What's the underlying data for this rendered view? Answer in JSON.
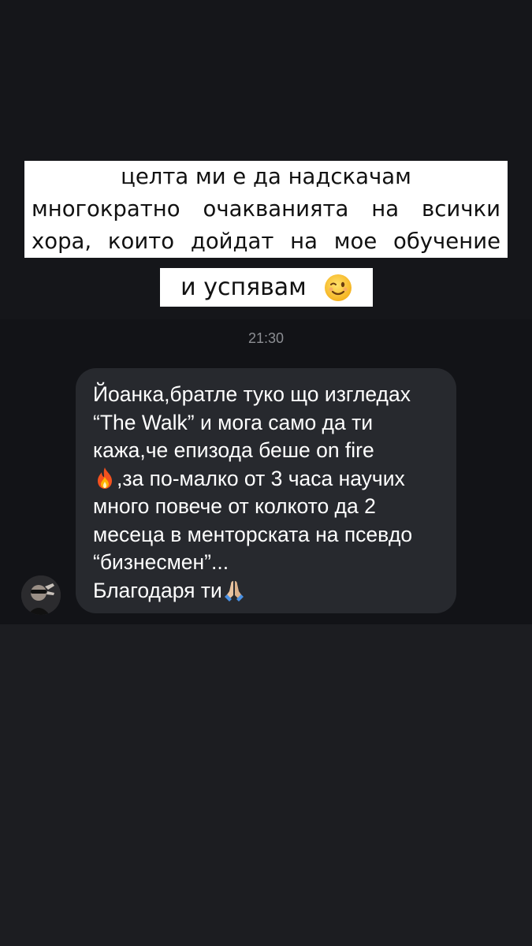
{
  "story_caption": {
    "line1": "целта ми е да надскачам",
    "line2": "многократно очакванията на всички",
    "line3": "хора, които дойдат на мое обучение",
    "line4": "и успявам",
    "emoji": "winking-face-icon"
  },
  "chat": {
    "timestamp": "21:30",
    "message": {
      "lines": [
        "Йоанка,братле туко що изгледах",
        "“The Walk” и мога само да ти",
        "кажа,че епизода беше on fire",
        ",за по-малко от 3 часа научих",
        "много повече от колкото да 2",
        "месеца в менторската на псевдо",
        "“бизнесмен”...",
        "Благодаря ти"
      ],
      "emoji_fire": "fire-icon",
      "emoji_pray": "folded-hands-icon"
    },
    "sender_avatar": "avatar"
  },
  "colors": {
    "page_bg": "#1c1d21",
    "chat_bg": "#121317",
    "bubble_bg": "#27292e",
    "caption_bg": "#ffffff",
    "timestamp": "#8c8e93"
  }
}
